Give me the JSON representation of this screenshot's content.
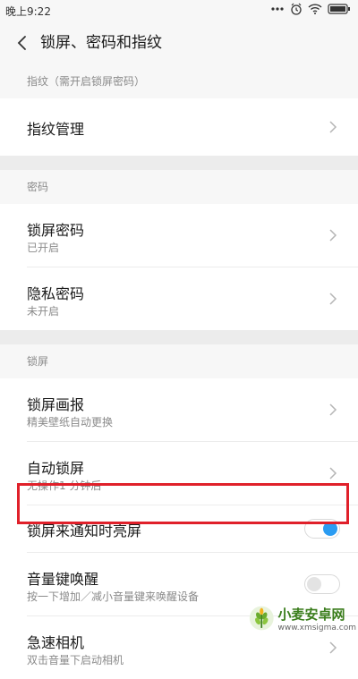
{
  "status_bar": {
    "time": "晚上9:22",
    "icons": [
      "more-dots-icon",
      "alarm-icon",
      "wifi-icon",
      "battery-icon"
    ]
  },
  "app_bar": {
    "title": "锁屏、密码和指纹"
  },
  "sections": [
    {
      "header": "指纹（需开启锁屏密码）",
      "items": [
        {
          "label": "指纹管理",
          "sub": "",
          "control": "chevron"
        }
      ]
    },
    {
      "header": "密码",
      "items": [
        {
          "label": "锁屏密码",
          "sub": "已开启",
          "control": "chevron"
        },
        {
          "label": "隐私密码",
          "sub": "未开启",
          "control": "chevron"
        }
      ]
    },
    {
      "header": "锁屏",
      "items": [
        {
          "label": "锁屏画报",
          "sub": "精美壁纸自动更换",
          "control": "chevron"
        },
        {
          "label": "自动锁屏",
          "sub": "无操作1 分钟后",
          "control": "chevron"
        },
        {
          "label": "锁屏来通知时亮屏",
          "sub": "",
          "control": "switch",
          "checked": true
        },
        {
          "label": "音量键唤醒",
          "sub": "按一下增加／减小音量键来唤醒设备",
          "control": "switch",
          "checked": false
        },
        {
          "label": "急速相机",
          "sub": "双击音量下启动相机",
          "control": "chevron"
        }
      ]
    }
  ],
  "colors": {
    "accent": "#2b9cf2",
    "highlight": "#e0202a",
    "background": "#f7f7f7",
    "card": "#ffffff"
  },
  "watermark": {
    "title": "小麦安卓网",
    "url": "www.xmsigma.com"
  }
}
